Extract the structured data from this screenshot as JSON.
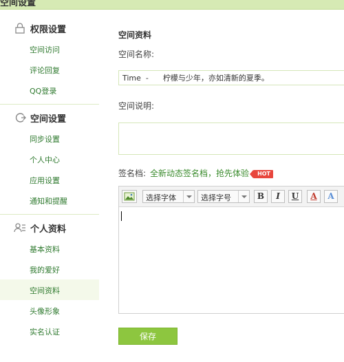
{
  "header": {
    "title": "空间设置"
  },
  "sidebar": {
    "sections": [
      {
        "label": "权限设置",
        "icon": "lock-icon",
        "items": [
          {
            "label": "空间访问"
          },
          {
            "label": "评论回复"
          },
          {
            "label": "QQ登录"
          }
        ]
      },
      {
        "label": "空间设置",
        "icon": "sync-icon",
        "items": [
          {
            "label": "同步设置"
          },
          {
            "label": "个人中心"
          },
          {
            "label": "应用设置"
          },
          {
            "label": "通知和提醒"
          }
        ]
      },
      {
        "label": "个人资料",
        "icon": "user-profile-icon",
        "items": [
          {
            "label": "基本资料"
          },
          {
            "label": "我的爱好"
          },
          {
            "label": "空间资料",
            "active": true
          },
          {
            "label": "头像形象"
          },
          {
            "label": "实名认证"
          }
        ]
      }
    ]
  },
  "main": {
    "title": "空间资料",
    "name_label": "空间名称:",
    "name_value": "Time  -      柠檬与少年，亦如清新的夏季。",
    "desc_label": "空间说明:",
    "desc_value": "",
    "sign_label": "签名档:",
    "sign_link": "全新动态签名档，抢先体验",
    "hot_badge": "HOT",
    "editor": {
      "font_select": "选择字体",
      "size_select": "选择字号",
      "bold": "B",
      "italic": "I",
      "underline": "U",
      "font_color": "A",
      "bg_color": "A"
    },
    "save_label": "保存"
  },
  "colors": {
    "accent": "#8dc63f",
    "link": "#2f7a2f",
    "hot": "#e8463d"
  }
}
